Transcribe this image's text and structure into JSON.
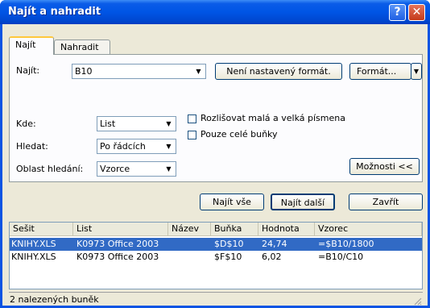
{
  "window": {
    "title": "Najít a nahradit"
  },
  "titlebar_buttons": {
    "help": "?",
    "close": "✕"
  },
  "tabs": [
    {
      "label": "Najít"
    },
    {
      "label": "Nahradit"
    }
  ],
  "find": {
    "label": "Najít:",
    "value": "B10",
    "format_status": "Není nastavený formát.",
    "format_button": "Formát..."
  },
  "options": {
    "within_label": "Kde:",
    "within_value": "List",
    "search_label": "Hledat:",
    "search_value": "Po řádcích",
    "lookin_label": "Oblast hledání:",
    "lookin_value": "Vzorce",
    "match_case_label": "Rozlišovat malá a velká písmena",
    "match_case_checked": false,
    "entire_cell_label": "Pouze celé buňky",
    "entire_cell_checked": false,
    "options_button": "Možnosti <<"
  },
  "actions": {
    "find_all": "Najít vše",
    "find_next": "Najít další",
    "close": "Zavřít"
  },
  "results": {
    "columns": [
      "Sešit",
      "List",
      "Název",
      "Buňka",
      "Hodnota",
      "Vzorec"
    ],
    "rows": [
      [
        "KNIHY.XLS",
        "K0973 Office 2003",
        "",
        "$D$10",
        "24,74",
        "=$B10/1800"
      ],
      [
        "KNIHY.XLS",
        "K0973 Office 2003",
        "",
        "$F$10",
        "6,02",
        "=B10/C10"
      ]
    ],
    "selected_row": 0
  },
  "status": {
    "text": "2 nalezených buněk"
  },
  "colors": {
    "title_bar": "#0055e5",
    "selection": "#316ac5",
    "dialog_bg": "#ece9d8"
  }
}
